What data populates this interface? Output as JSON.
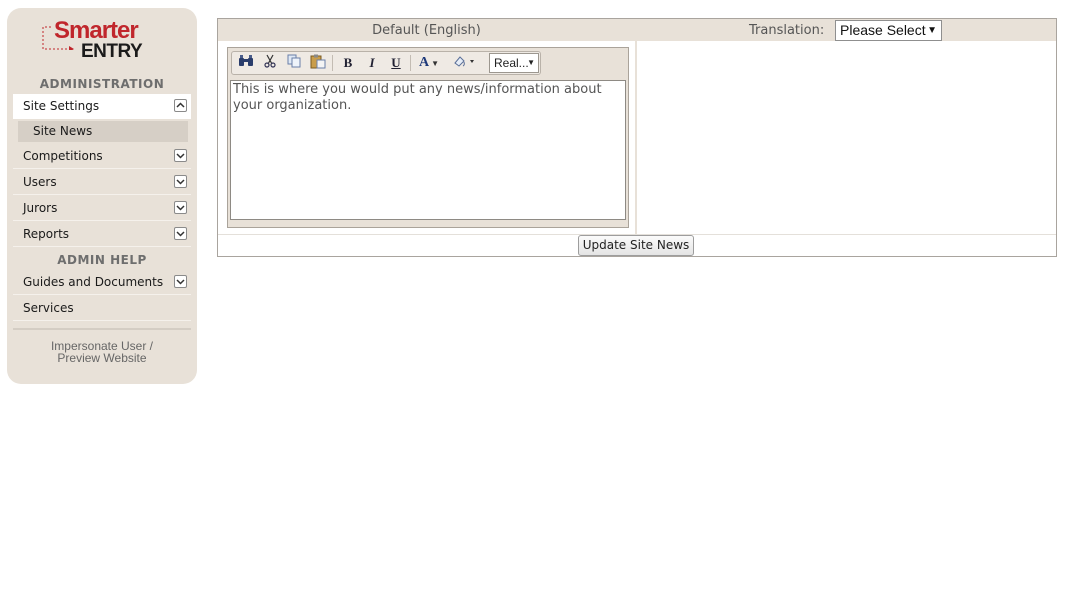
{
  "logo": {
    "line1": "Smarter",
    "line2": "ENTRY",
    "brand_color": "#c0262c"
  },
  "sidebar": {
    "admin_heading": "ADMINISTRATION",
    "items": [
      {
        "label": "Site Settings",
        "state": "expanded"
      },
      {
        "label": "Competitions",
        "state": "collapsed"
      },
      {
        "label": "Users",
        "state": "collapsed"
      },
      {
        "label": "Jurors",
        "state": "collapsed"
      },
      {
        "label": "Reports",
        "state": "collapsed"
      }
    ],
    "sub_item": "Site News",
    "help_heading": "ADMIN HELP",
    "help_items": [
      {
        "label": "Guides and Documents",
        "state": "collapsed"
      },
      {
        "label": "Services"
      }
    ],
    "impersonate_line1": "Impersonate User /",
    "impersonate_line2": "Preview Website"
  },
  "main": {
    "default_heading": "Default (English)",
    "translation_label": "Translation:",
    "translation_select": "Please Select",
    "editor": {
      "toolbar_icons": [
        "binoculars-icon",
        "cut-icon",
        "copy-icon",
        "paste-icon",
        "bold-icon",
        "italic-icon",
        "underline-icon",
        "font-color-icon",
        "highlight-icon"
      ],
      "font_dropdown": "Real...",
      "content": "This is where you would put any news/information about your organization."
    },
    "update_button": "Update Site News"
  },
  "colors": {
    "panel_bg": "#e8e1d8",
    "active_sub": "#d6cfc6"
  }
}
